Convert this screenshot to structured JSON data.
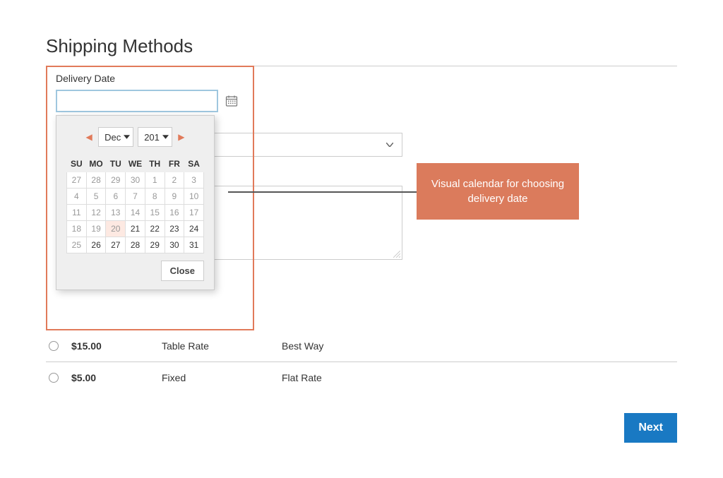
{
  "page_title": "Shipping Methods",
  "delivery": {
    "label": "Delivery Date",
    "input_value": "",
    "input_placeholder": ""
  },
  "datepicker": {
    "month": "Dec",
    "year": "201",
    "weekdays": [
      "SU",
      "MO",
      "TU",
      "WE",
      "TH",
      "FR",
      "SA"
    ],
    "weeks": [
      [
        {
          "d": "27",
          "muted": true
        },
        {
          "d": "28",
          "muted": true
        },
        {
          "d": "29",
          "muted": true
        },
        {
          "d": "30",
          "muted": true
        },
        {
          "d": "1",
          "muted": true
        },
        {
          "d": "2",
          "muted": true
        },
        {
          "d": "3",
          "muted": true
        }
      ],
      [
        {
          "d": "4",
          "muted": true
        },
        {
          "d": "5",
          "muted": true
        },
        {
          "d": "6",
          "muted": true
        },
        {
          "d": "7",
          "muted": true
        },
        {
          "d": "8",
          "muted": true
        },
        {
          "d": "9",
          "muted": true
        },
        {
          "d": "10",
          "muted": true
        }
      ],
      [
        {
          "d": "11",
          "muted": true
        },
        {
          "d": "12",
          "muted": true
        },
        {
          "d": "13",
          "muted": true
        },
        {
          "d": "14",
          "muted": true
        },
        {
          "d": "15",
          "muted": true
        },
        {
          "d": "16",
          "muted": true
        },
        {
          "d": "17",
          "muted": true
        }
      ],
      [
        {
          "d": "18",
          "muted": true
        },
        {
          "d": "19",
          "muted": true
        },
        {
          "d": "20",
          "muted": true,
          "today": true
        },
        {
          "d": "21"
        },
        {
          "d": "22"
        },
        {
          "d": "23"
        },
        {
          "d": "24"
        }
      ],
      [
        {
          "d": "25",
          "muted": true
        },
        {
          "d": "26"
        },
        {
          "d": "27"
        },
        {
          "d": "28"
        },
        {
          "d": "29"
        },
        {
          "d": "30"
        },
        {
          "d": "31"
        }
      ]
    ],
    "close_label": "Close"
  },
  "callout_text": "Visual calendar for choosing delivery date",
  "shipping_rows": [
    {
      "price": "$15.00",
      "method": "Table Rate",
      "carrier": "Best Way"
    },
    {
      "price": "$5.00",
      "method": "Fixed",
      "carrier": "Flat Rate"
    }
  ],
  "next_label": "Next"
}
